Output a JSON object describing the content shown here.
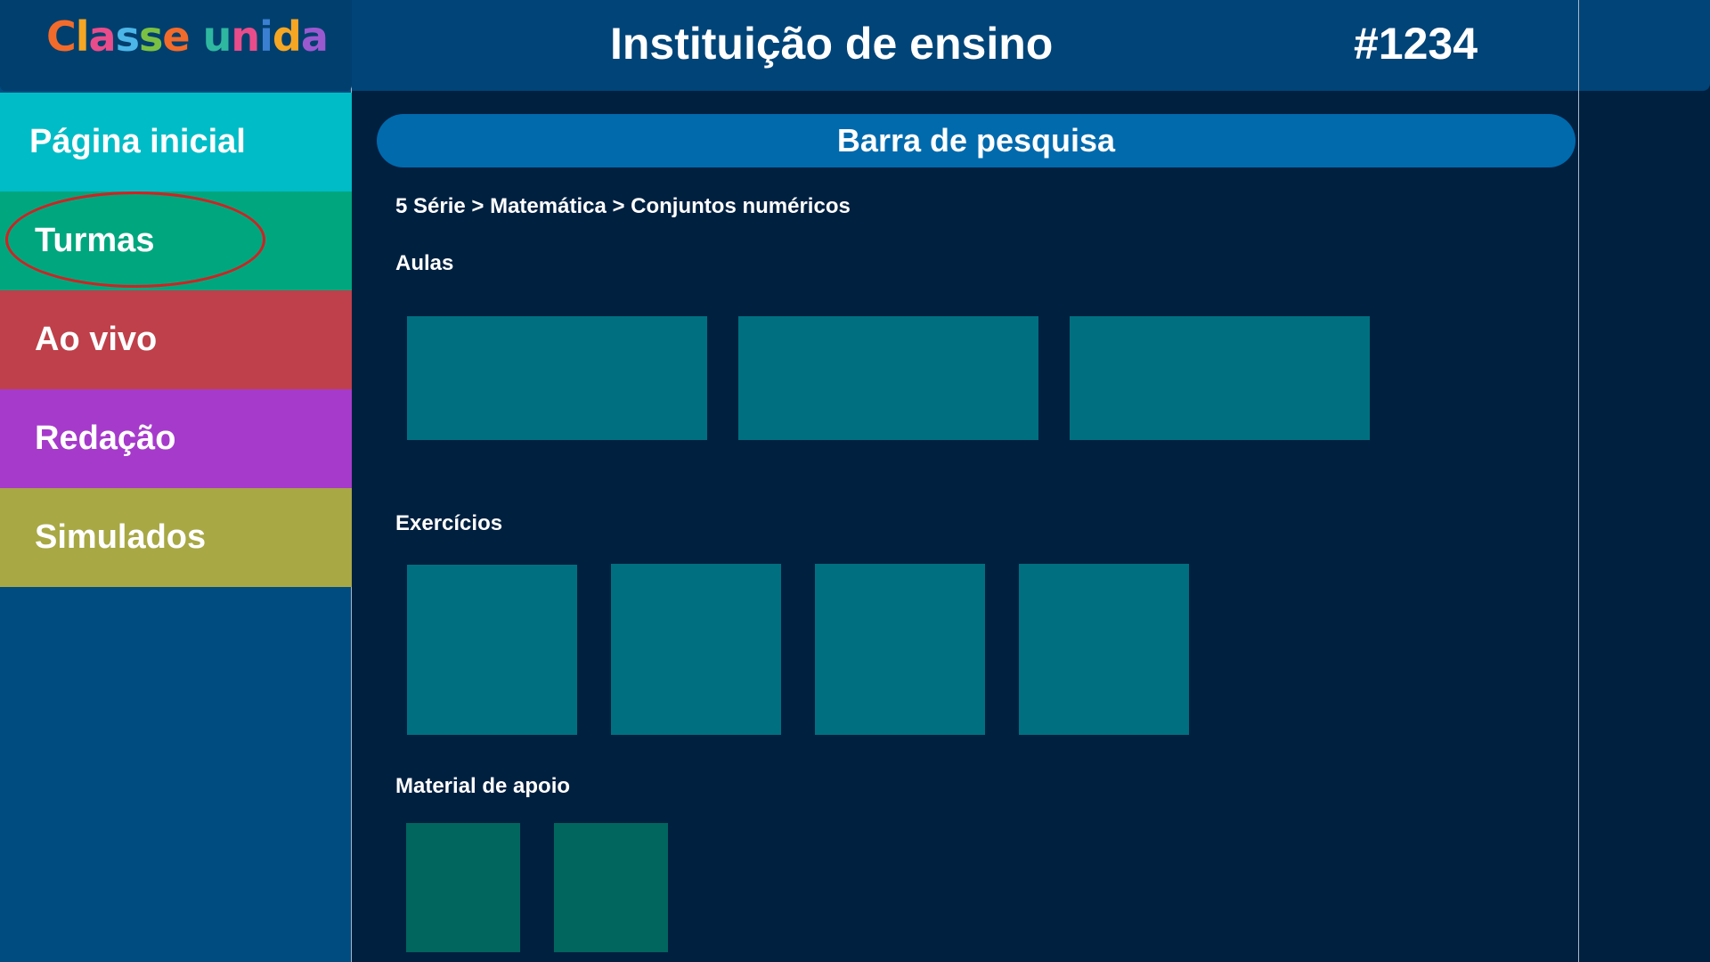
{
  "logo": {
    "text": "Classe unida",
    "letters": [
      {
        "ch": "C",
        "color": "#f26b2a"
      },
      {
        "ch": "l",
        "color": "#f5a623"
      },
      {
        "ch": "a",
        "color": "#e94c8a"
      },
      {
        "ch": "s",
        "color": "#4cb6e8"
      },
      {
        "ch": "s",
        "color": "#7ac143"
      },
      {
        "ch": "e",
        "color": "#f26b2a"
      },
      {
        "ch": " ",
        "color": "#ffffff"
      },
      {
        "ch": "u",
        "color": "#2fb8a0"
      },
      {
        "ch": "n",
        "color": "#e94c8a"
      },
      {
        "ch": "i",
        "color": "#3a7fd1"
      },
      {
        "ch": "d",
        "color": "#f5a623"
      },
      {
        "ch": "a",
        "color": "#9b59d0"
      }
    ]
  },
  "sidebar": {
    "items": [
      {
        "label": "Página inicial",
        "color": "#00bcc6"
      },
      {
        "label": "Turmas",
        "color": "#00a67e",
        "highlighted": true
      },
      {
        "label": "Ao vivo",
        "color": "#bf404a"
      },
      {
        "label": "Redação",
        "color": "#a63acb"
      },
      {
        "label": "Simulados",
        "color": "#a8a845"
      }
    ]
  },
  "header": {
    "title": "Instituição de ensino",
    "code": "#1234"
  },
  "search": {
    "label": "Barra de pesquisa"
  },
  "breadcrumb": "5 Série > Matemática > Conjuntos numéricos",
  "sections": {
    "aulas": {
      "title": "Aulas",
      "count": 3
    },
    "exercicios": {
      "title": "Exercícios",
      "count": 4
    },
    "material": {
      "title": "Material de apoio",
      "count": 2
    }
  },
  "colors": {
    "background": "#002040",
    "sidebar": "#004c80",
    "header": "#004478",
    "search_bar": "#006aad",
    "card": "#007080",
    "support_card": "#00665e",
    "highlight_oval": "#d42020"
  }
}
